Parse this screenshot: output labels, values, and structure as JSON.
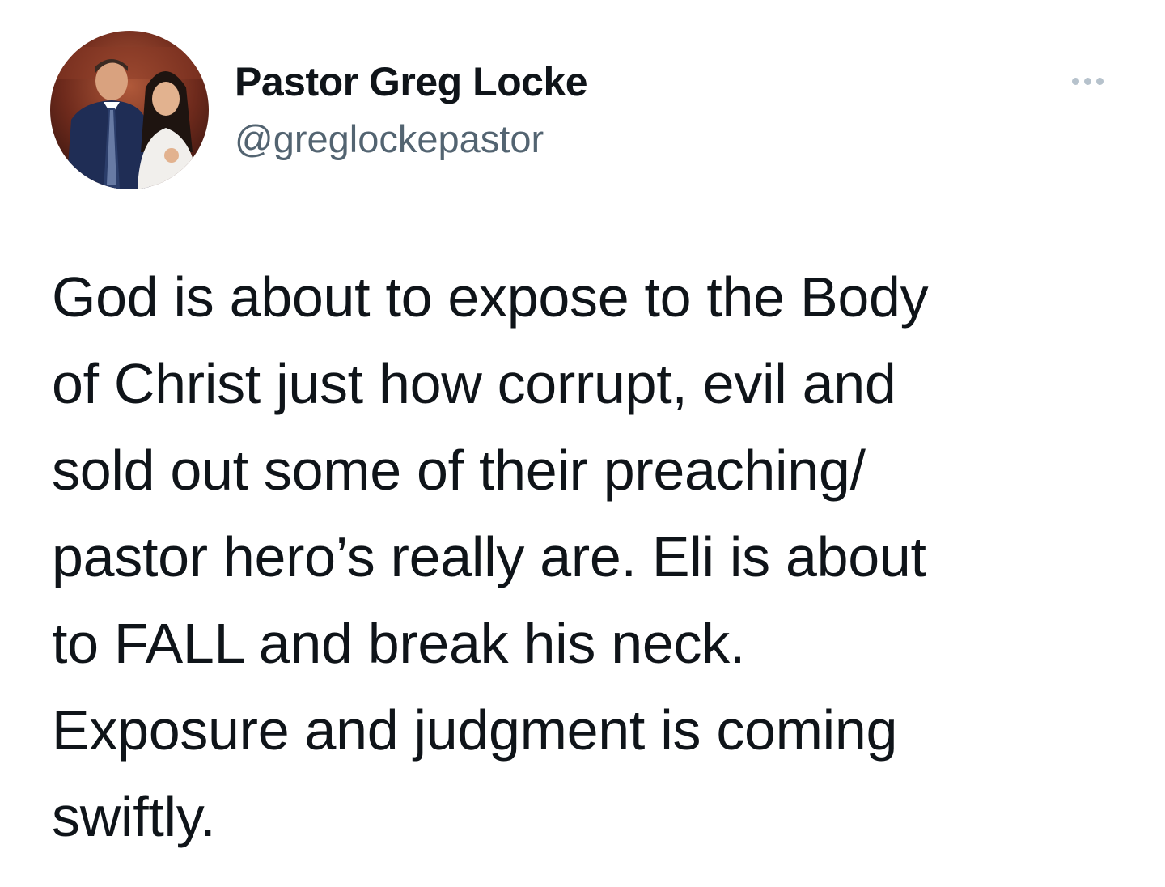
{
  "author": {
    "display_name": "Pastor Greg Locke",
    "handle": "@greglockepastor",
    "avatar_icon": "profile-photo"
  },
  "more_icon": "more-options-icon",
  "tweet": {
    "lines": [
      "God is about to expose to the Body",
      "of Christ just how corrupt, evil and",
      "sold out some of their preaching/",
      "pastor hero’s really are. Eli is about",
      "to FALL and break his neck.",
      "Exposure and judgment is coming",
      "swiftly."
    ]
  },
  "colors": {
    "text_primary": "#0f1419",
    "text_secondary": "#536471",
    "more_dots": "#b6c2cc",
    "background": "#ffffff"
  }
}
